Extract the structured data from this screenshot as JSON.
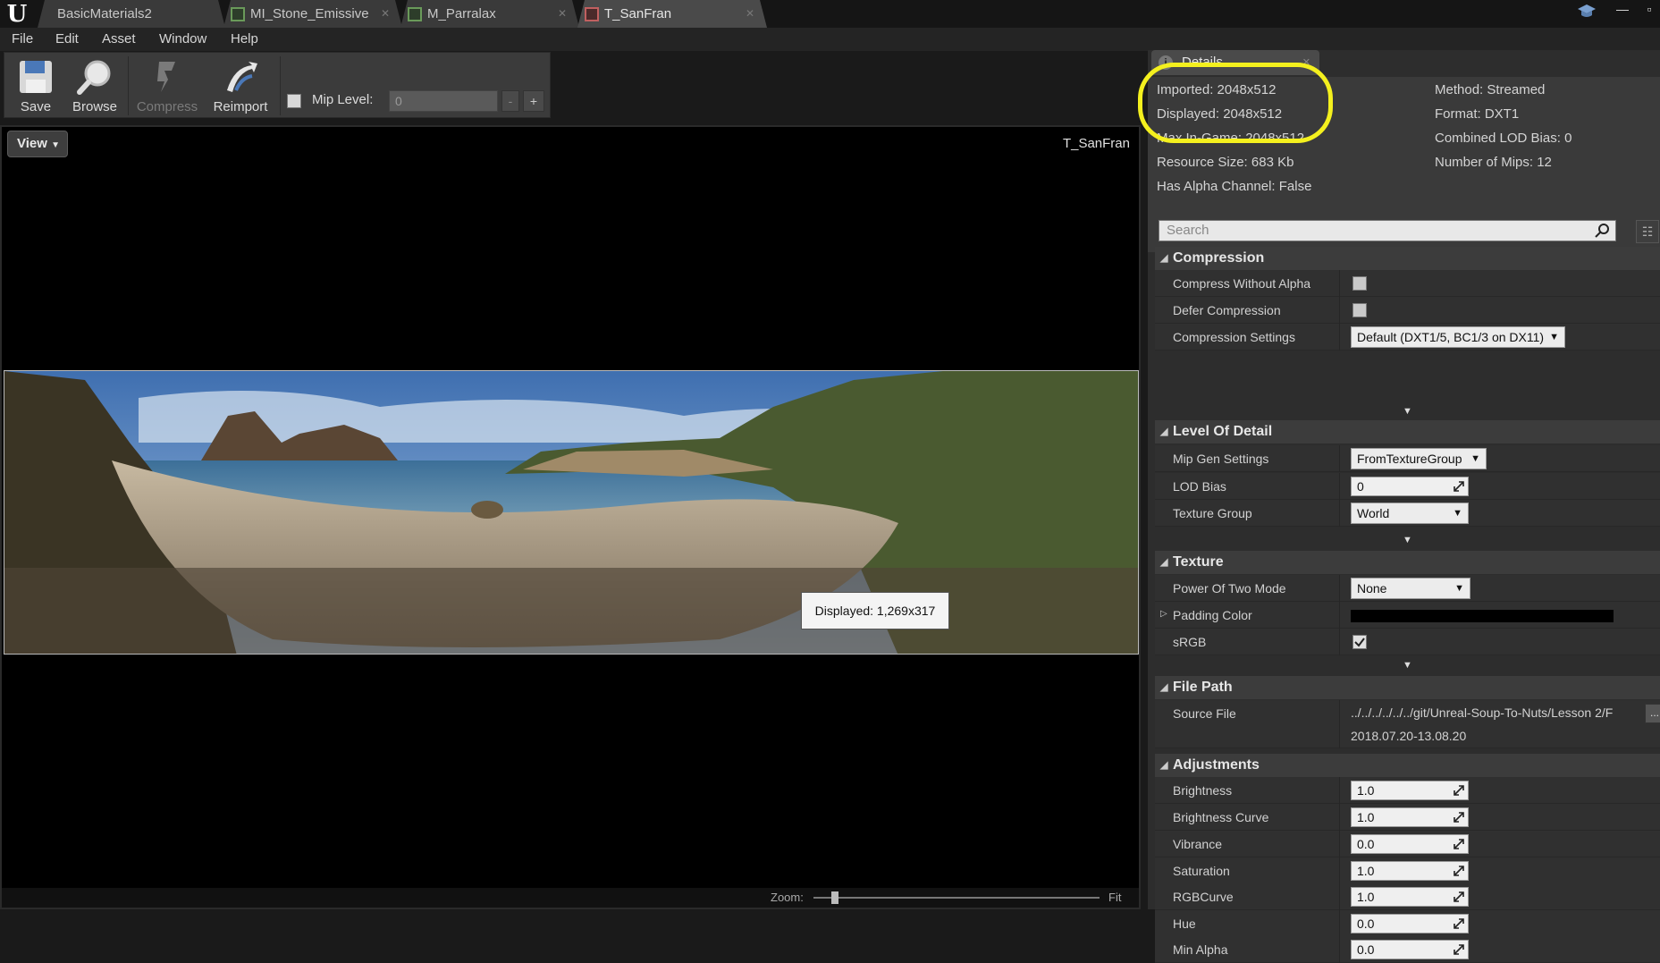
{
  "tabs": [
    {
      "label": "BasicMaterials2",
      "active": false
    },
    {
      "label": "MI_Stone_Emissive",
      "active": false
    },
    {
      "label": "M_Parralax",
      "active": false
    },
    {
      "label": "T_SanFran",
      "active": true
    }
  ],
  "menu": [
    "File",
    "Edit",
    "Asset",
    "Window",
    "Help"
  ],
  "toolbar": {
    "save": "Save",
    "browse": "Browse",
    "compress": "Compress",
    "reimport": "Reimport",
    "mip_label": "Mip Level:",
    "mip_value": "0",
    "minus": "-",
    "plus": "+"
  },
  "viewport": {
    "view_label": "View",
    "asset_name": "T_SanFran",
    "tooltip": "Displayed: 1,269x317",
    "zoom_label": "Zoom:",
    "zoom_mode": "Fit"
  },
  "details": {
    "tab_label": "Details",
    "info": {
      "imported": "Imported: 2048x512",
      "displayed": "Displayed: 2048x512",
      "max_in_game": "Max In-Game: 2048x512",
      "resource_size": "Resource Size: 683 Kb",
      "has_alpha": "Has Alpha Channel: False",
      "method": "Method: Streamed",
      "format": "Format: DXT1",
      "lod_bias": "Combined LOD Bias: 0",
      "mips": "Number of Mips: 12"
    },
    "search_placeholder": "Search",
    "compression": {
      "title": "Compression",
      "compress_without_alpha": "Compress Without Alpha",
      "defer_compression": "Defer Compression",
      "compression_settings": "Compression Settings",
      "compression_settings_value": "Default (DXT1/5, BC1/3 on DX11)"
    },
    "lod": {
      "title": "Level Of Detail",
      "mip_gen": "Mip Gen Settings",
      "mip_gen_value": "FromTextureGroup",
      "lod_bias": "LOD Bias",
      "lod_bias_value": "0",
      "texture_group": "Texture Group",
      "texture_group_value": "World"
    },
    "texture": {
      "title": "Texture",
      "pot_mode": "Power Of Two Mode",
      "pot_mode_value": "None",
      "padding_color": "Padding Color",
      "srgb": "sRGB"
    },
    "file_path": {
      "title": "File Path",
      "source_file": "Source File",
      "source_file_value": "../../../../../../git/Unreal-Soup-To-Nuts/Lesson 2/F",
      "browse_btn": "...",
      "timestamp": "2018.07.20-13.08.20"
    },
    "adjustments": {
      "title": "Adjustments",
      "rows": [
        {
          "label": "Brightness",
          "value": "1.0"
        },
        {
          "label": "Brightness Curve",
          "value": "1.0"
        },
        {
          "label": "Vibrance",
          "value": "0.0"
        },
        {
          "label": "Saturation",
          "value": "1.0"
        },
        {
          "label": "RGBCurve",
          "value": "1.0"
        },
        {
          "label": "Hue",
          "value": "0.0"
        },
        {
          "label": "Min Alpha",
          "value": "0.0"
        }
      ]
    }
  },
  "colors": {
    "highlight": "#f4f01e",
    "padding_color": "#000000"
  }
}
